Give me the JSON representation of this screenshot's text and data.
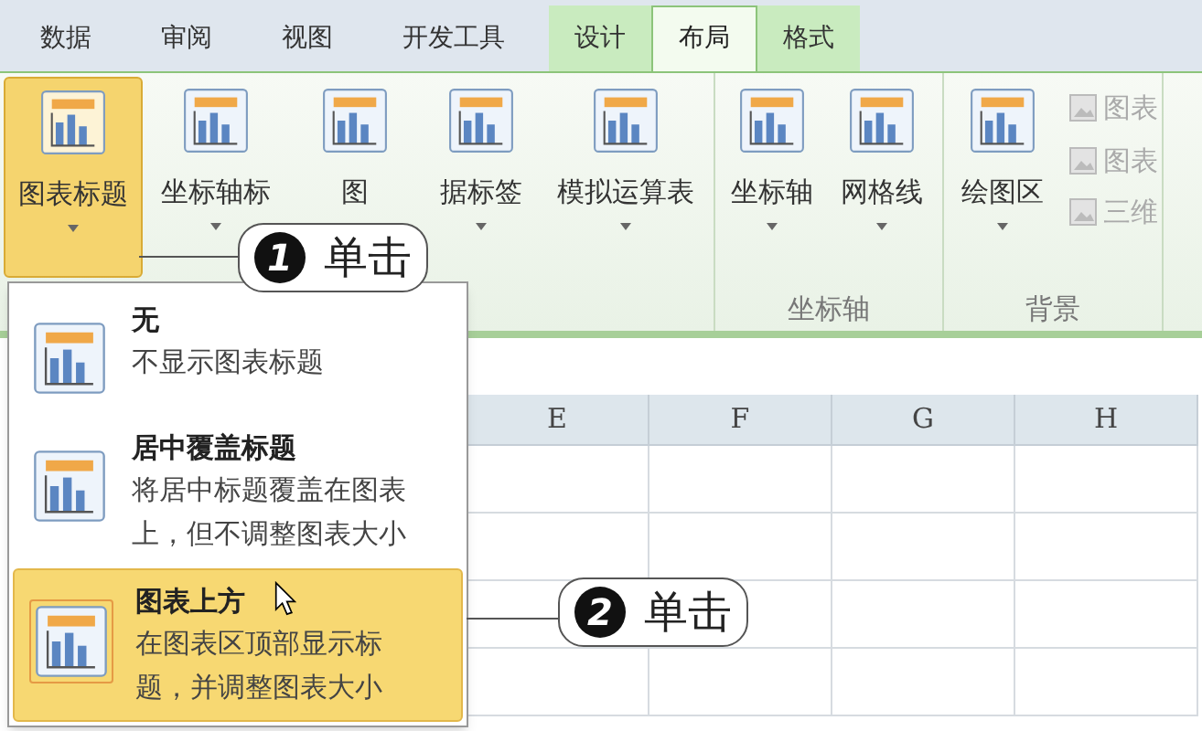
{
  "tabs": [
    {
      "label": "数据",
      "kind": "normal",
      "selected": false
    },
    {
      "label": "审阅",
      "kind": "normal",
      "selected": false
    },
    {
      "label": "视图",
      "kind": "normal",
      "selected": false
    },
    {
      "label": "开发工具",
      "kind": "normal",
      "selected": false
    },
    {
      "label": "设计",
      "kind": "contextual",
      "selected": false
    },
    {
      "label": "布局",
      "kind": "contextual",
      "selected": true
    },
    {
      "label": "格式",
      "kind": "contextual",
      "selected": false
    }
  ],
  "ribbon": {
    "groups": [
      {
        "buttons": [
          {
            "label": "图表标题",
            "selected": true
          },
          {
            "label": "坐标轴标",
            "selected": false
          },
          {
            "label": "图",
            "selected": false
          },
          {
            "label": "据标签",
            "selected": false
          },
          {
            "label": "模拟运算表",
            "selected": false
          }
        ]
      },
      {
        "label": "坐标轴",
        "buttons": [
          {
            "label": "坐标轴",
            "selected": false
          },
          {
            "label": "网格线",
            "selected": false
          }
        ]
      },
      {
        "label": "背景",
        "buttons": [
          {
            "label": "绘图区",
            "selected": false
          }
        ],
        "small_buttons": [
          {
            "label": "图表",
            "disabled": true
          },
          {
            "label": "图表",
            "disabled": true
          },
          {
            "label": "三维",
            "disabled": true
          }
        ]
      }
    ]
  },
  "dropdown": {
    "items": [
      {
        "title": "无",
        "description": "不显示图表标题",
        "selected": false
      },
      {
        "title": "居中覆盖标题",
        "description": "将居中标题覆盖在图表上，但不调整图表大小",
        "selected": false
      },
      {
        "title": "图表上方",
        "description": "在图表区顶部显示标题，并调整图表大小",
        "selected": true
      }
    ]
  },
  "sheet": {
    "columns": [
      "E",
      "F",
      "G",
      "H"
    ]
  },
  "callouts": [
    {
      "number": "1",
      "text": "单击"
    },
    {
      "number": "2",
      "text": "单击"
    }
  ]
}
